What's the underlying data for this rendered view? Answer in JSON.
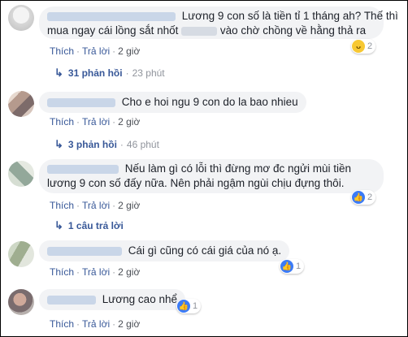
{
  "comments": [
    {
      "line1": "Lương 9 con số là tiền tỉ 1 tháng ah? Thế thì",
      "line2a": "mua ngay cái lồng sắt nhốt",
      "line2b": "vào chờ chồng về hằng thả ra",
      "actions": {
        "like": "Thích",
        "reply": "Trả lời",
        "time": "2 giờ"
      },
      "reaction": {
        "icon": "haha",
        "count": "2"
      },
      "replies": {
        "label": "31 phản hồi",
        "time": "23 phút"
      }
    },
    {
      "text": "Cho e hoi ngu 9 con do la bao nhieu",
      "actions": {
        "like": "Thích",
        "reply": "Trả lời",
        "time": "2 giờ"
      },
      "replies": {
        "label": "3 phản hồi",
        "time": "46 phút"
      }
    },
    {
      "line1": "Nếu làm gì có lỗi thì đừng mơ đc ngửi mùi tiền",
      "line2": "lương 9 con số đấy nữa. Nên phải ngậm ngùi chịu đựng thôi.",
      "actions": {
        "like": "Thích",
        "reply": "Trả lời",
        "time": "2 giờ"
      },
      "reaction": {
        "icon": "like",
        "count": "2"
      },
      "replies": {
        "label": "1 câu trả lời"
      }
    },
    {
      "text": "Cái gì cũng có cái giá của nó ạ.",
      "actions": {
        "like": "Thích",
        "reply": "Trả lời",
        "time": "2 giờ"
      },
      "reaction": {
        "icon": "like",
        "count": "1"
      }
    },
    {
      "text": "Lương cao nhể",
      "actions": {
        "like": "Thích",
        "reply": "Trả lời",
        "time": "2 giờ"
      },
      "reaction": {
        "icon": "like",
        "count": "1"
      }
    }
  ],
  "icons": {
    "reply_arrow": "reply-arrow-icon",
    "like": "like-icon",
    "haha": "haha-icon"
  },
  "colors": {
    "link": "#385898",
    "bubble": "#f2f3f5",
    "like": "#3b7bf7",
    "haha": "#f7c833"
  }
}
